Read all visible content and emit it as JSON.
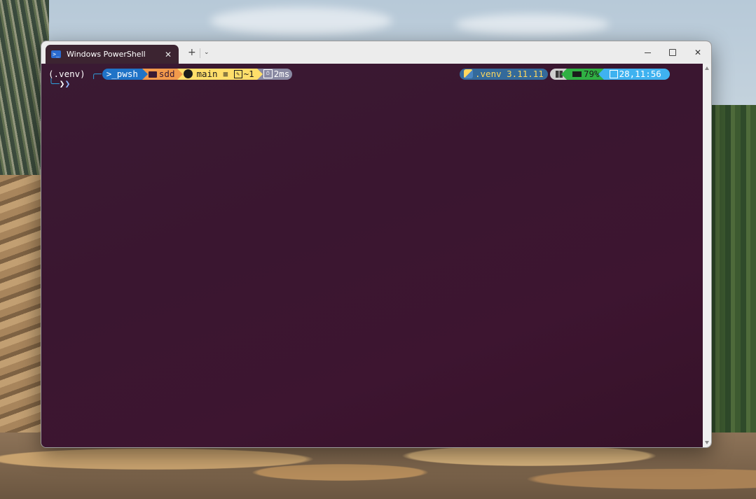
{
  "window": {
    "tab_title": "Windows PowerShell",
    "tab_close": "✕",
    "new_tab": "+",
    "tab_dropdown": "⌄",
    "minimize_label": "",
    "maximize_label": "",
    "close_label": "✕",
    "background_color": "#3b1731"
  },
  "prompt": {
    "venv": "(.venv)",
    "corner_top": "╭─",
    "shell": ">_pwsh",
    "path": "sdd",
    "branch": "main ≡",
    "git_status": "~1",
    "exec_time": "2ms",
    "corner_bottom": "╰─",
    "prompt_char_1": "❯",
    "prompt_char_2": "❯"
  },
  "status": {
    "python": ".venv 3.11.11",
    "battery": "79%",
    "datetime": "28,11:56"
  },
  "icons": {
    "tab": "powershell-icon",
    "path": "folder-icon",
    "git": "github-icon",
    "python": "python-icon",
    "os": "windows-icon",
    "battery": "battery-icon",
    "date": "calendar-icon"
  },
  "colors": {
    "pwsh_segment": "#1f73c7",
    "path_segment": "#f29a4b",
    "git_segment": "#ffde6a",
    "time_segment": "#8a8aa3",
    "python_segment": "#346a9b",
    "battery_segment": "#2fb043",
    "date_segment": "#3fb2f0"
  }
}
